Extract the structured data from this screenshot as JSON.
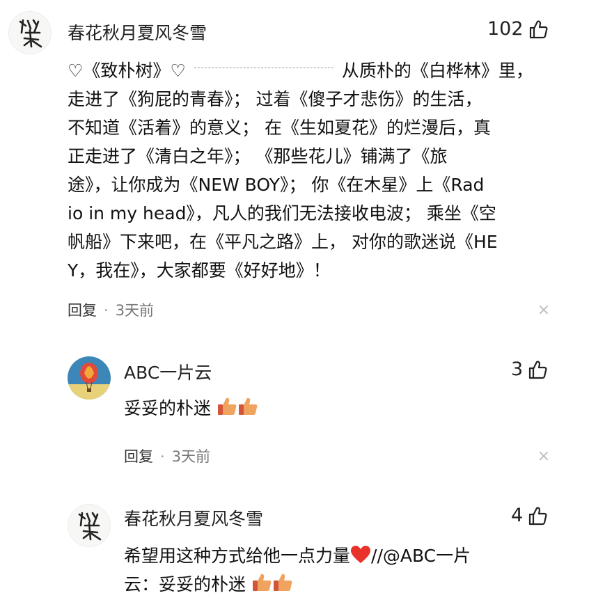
{
  "comments": [
    {
      "user": "春花秋月夏风冬雪",
      "likes": "102",
      "lines": [
        "♡《致朴树》♡",
        "从质朴的《白桦林》里，",
        "走进了《狗屁的青春》； 过着《傻子才悲伤》的生活，",
        "不知道《活着》的意义； 在《生如夏花》的烂漫后，真",
        "正走进了《清白之年》； 《那些花儿》铺满了《旅",
        "途》，让你成为《NEW BOY》； 你《在木星》上《Rad",
        "io in my head》，凡人的我们无法接收电波； 乘坐《空",
        "帆船》下来吧，在《平凡之路》上， 对你的歌迷说《HE",
        "Y，我在》，大家都要《好好地》！"
      ],
      "reply_label": "回复",
      "time": "3天前"
    },
    {
      "user": "ABC一片云",
      "likes": "3",
      "text": "妥妥的朴迷",
      "reply_label": "回复",
      "time": "3天前"
    },
    {
      "user": "春花秋月夏风冬雪",
      "likes": "4",
      "line1": "希望用这种方式给他一点力量",
      "line1_suffix": "//@ABC一片",
      "line2": "云：妥妥的朴迷"
    }
  ],
  "colors": {
    "heart_red": "#e8322b",
    "thumb_orange": "#f0a35e",
    "thumb_cuff": "#d2553a"
  },
  "icons": {
    "like": "thumbs-up-outline-icon",
    "close": "close-icon",
    "thumb_emoji": "thumbs-up-emoji-icon",
    "heart_emoji": "red-heart-emoji-icon"
  }
}
